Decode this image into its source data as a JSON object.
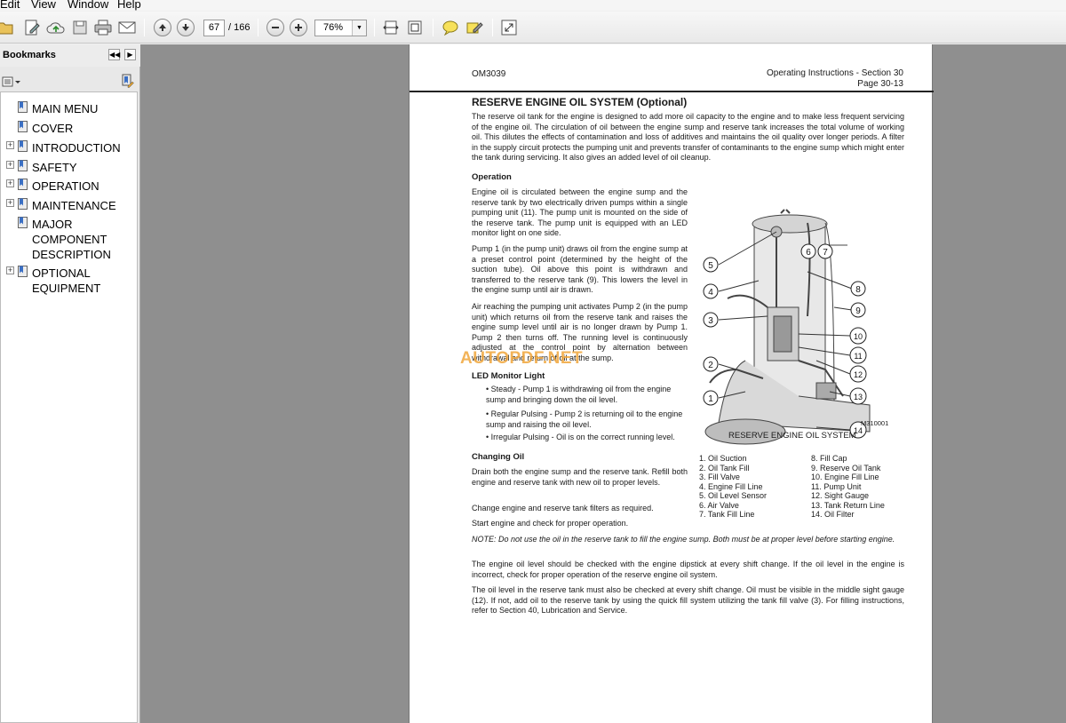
{
  "menu": [
    "Edit",
    "View",
    "Window",
    "Help"
  ],
  "toolbar": {
    "current_page": "67",
    "total_pages": "/ 166",
    "zoom": "76%"
  },
  "bookmarks": {
    "title": "Bookmarks",
    "collapse_label": "◀◀",
    "next_label": "▶",
    "items": [
      {
        "lines": [
          "MAIN MENU"
        ],
        "expandable": false
      },
      {
        "lines": [
          "COVER"
        ],
        "expandable": false
      },
      {
        "lines": [
          "INTRODUCTION"
        ],
        "expandable": true
      },
      {
        "lines": [
          "SAFETY"
        ],
        "expandable": true
      },
      {
        "lines": [
          "OPERATION"
        ],
        "expandable": true
      },
      {
        "lines": [
          "MAINTENANCE"
        ],
        "expandable": true
      },
      {
        "lines": [
          "MAJOR",
          "COMPONENT",
          "DESCRIPTION"
        ],
        "expandable": false
      },
      {
        "lines": [
          "OPTIONAL",
          "EQUIPMENT"
        ],
        "expandable": true
      }
    ]
  },
  "page": {
    "doc_code": "OM3039",
    "section": "Operating Instructions - Section 30",
    "page_no": "Page 30-13",
    "title": "RESERVE ENGINE OIL SYSTEM (Optional)",
    "intro": "The reserve oil tank for the engine is designed to add more oil capacity to the engine and to make less frequent servicing of the engine oil. The circulation of oil between the engine sump and reserve tank increases the total volume of working oil. This dilutes the effects of contamination and loss of additives and maintains the oil quality over longer periods. A filter in the supply circuit protects the pumping unit and prevents transfer of contaminants to the engine sump which might enter the tank during servicing. It also gives an added level of oil cleanup.",
    "operation_heading": "Operation",
    "operation_p1": "Engine oil is circulated between the engine sump and the reserve tank by two electrically driven pumps within a single pumping unit (11). The pump unit is mounted on the side of the reserve tank. The pump unit is equipped with an LED monitor light on one side.",
    "operation_p2": "Pump 1 (in the pump unit) draws oil from the engine sump at a preset control point (determined by the height of the suction tube). Oil above this point is withdrawn and transferred to the reserve tank (9). This lowers the level in the engine sump until air is drawn.",
    "operation_p3": "Air reaching the pumping unit activates Pump 2 (in the pump unit) which returns oil from the reserve tank and raises the engine sump level until air is no longer drawn by Pump 1. Pump 2 then turns off. The running level is continuously adjusted at the control point by alternation between withdrawal and return of oil at the sump.",
    "led_heading": "LED Monitor Light",
    "led_items": [
      "• Steady - Pump 1 is withdrawing oil from the engine sump and bringing down the oil level.",
      "• Regular Pulsing - Pump 2 is returning oil to the engine sump and raising the oil level.",
      "• Irregular Pulsing - Oil is on the correct running level."
    ],
    "changing_heading": "Changing Oil",
    "changing_p1": "Drain both the engine sump and the reserve tank. Refill both engine and reserve tank with new oil to proper levels.",
    "changing_p2": "Change engine and reserve tank filters as required.",
    "changing_p3": "Start engine and check for proper operation.",
    "note": "NOTE: Do not use the oil in the reserve tank to fill the engine sump. Both must be at proper level before starting engine.",
    "para_level1": "The engine oil level should be checked with the engine dipstick at every shift change. If the oil level in the engine is incorrect, check for proper operation of the reserve engine oil system.",
    "para_level2": "The oil level in the reserve tank must also be checked at every shift change. Oil must be visible in the middle sight gauge (12). If not, add oil to the reserve tank by using the quick fill system utilizing the tank fill valve (3). For filling instructions, refer to Section 40, Lubrication and Service.",
    "figure_code": "M310001",
    "figure_caption": "RESERVE ENGINE OIL SYSTEM",
    "callouts": [
      "1",
      "2",
      "3",
      "4",
      "5",
      "6",
      "7",
      "8",
      "9",
      "10",
      "11",
      "12",
      "13",
      "14"
    ],
    "legend_left": [
      "1. Oil Suction",
      "2. Oil Tank Fill",
      "3. Fill Valve",
      "4. Engine Fill Line",
      "5. Oil Level Sensor",
      "6. Air Valve",
      "7. Tank Fill Line"
    ],
    "legend_right": [
      "8. Fill Cap",
      "9. Reserve Oil Tank",
      "10. Engine Fill Line",
      "11. Pump Unit",
      "12. Sight Gauge",
      "13. Tank Return Line",
      "14. Oil Filter"
    ],
    "watermark": "AUTOPDF.NET"
  }
}
